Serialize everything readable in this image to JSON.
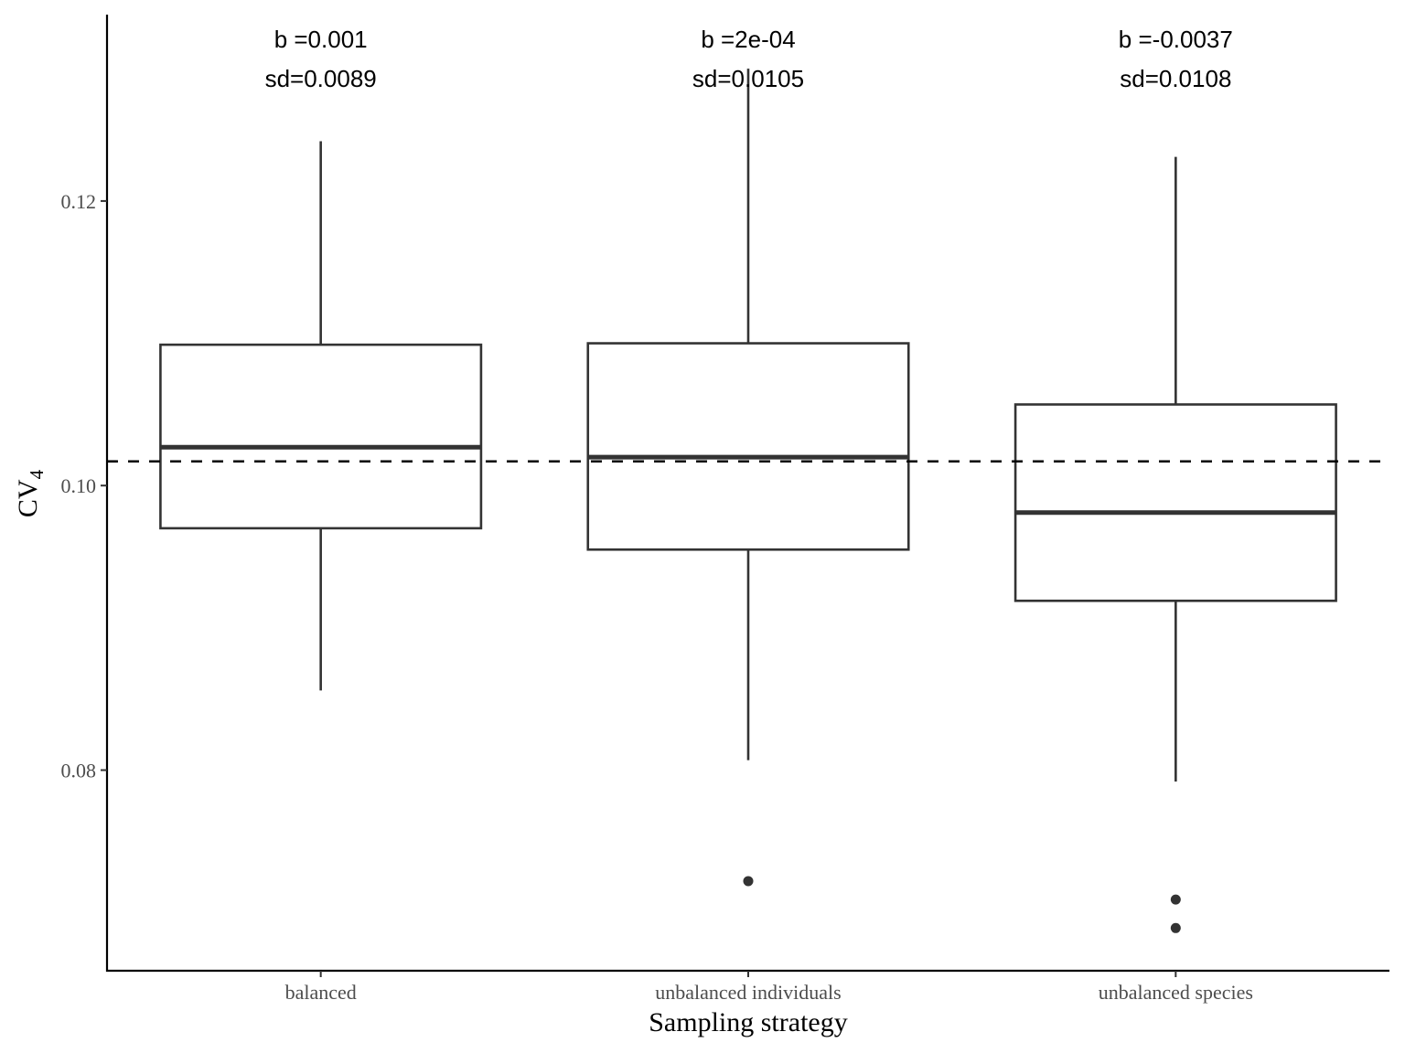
{
  "chart_data": {
    "type": "boxplot",
    "title": "",
    "xlabel": "Sampling strategy",
    "ylabel": "CV",
    "ylabel_subscript": "4",
    "ylim": [
      0.0659,
      0.1331
    ],
    "y_ticks": [
      0.08,
      0.1,
      0.12
    ],
    "y_tick_labels": [
      "0.08",
      "0.10",
      "0.12"
    ],
    "grid": false,
    "legend": "none",
    "categories": [
      "balanced",
      "unbalanced individuals",
      "unbalanced species"
    ],
    "boxes": [
      {
        "category": "balanced",
        "whisker_low": 0.0856,
        "q1": 0.097,
        "median": 0.1027,
        "q3": 0.1099,
        "whisker_high": 0.1242,
        "outliers": []
      },
      {
        "category": "unbalanced individuals",
        "whisker_low": 0.0807,
        "q1": 0.0955,
        "median": 0.102,
        "q3": 0.11,
        "whisker_high": 0.1293,
        "outliers": [
          0.0722
        ]
      },
      {
        "category": "unbalanced species",
        "whisker_low": 0.0792,
        "q1": 0.0919,
        "median": 0.0981,
        "q3": 0.1057,
        "whisker_high": 0.1231,
        "outliers": [
          0.0709,
          0.0689
        ]
      }
    ],
    "reference_line": {
      "value": 0.1017,
      "style": "dashed"
    },
    "annotations": [
      {
        "category": "balanced",
        "b_text": "b =0.001",
        "sd_text": "sd=0.0089"
      },
      {
        "category": "unbalanced individuals",
        "b_text": "b =2e-04",
        "sd_text": "sd=0.0105"
      },
      {
        "category": "unbalanced species",
        "b_text": "b =-0.0037",
        "sd_text": "sd=0.0108"
      }
    ],
    "colors": {
      "box_line": "#333333",
      "axis": "#000000",
      "tick_text": "#4d4d4d",
      "outlier": "#333333",
      "reference": "#000000"
    }
  }
}
